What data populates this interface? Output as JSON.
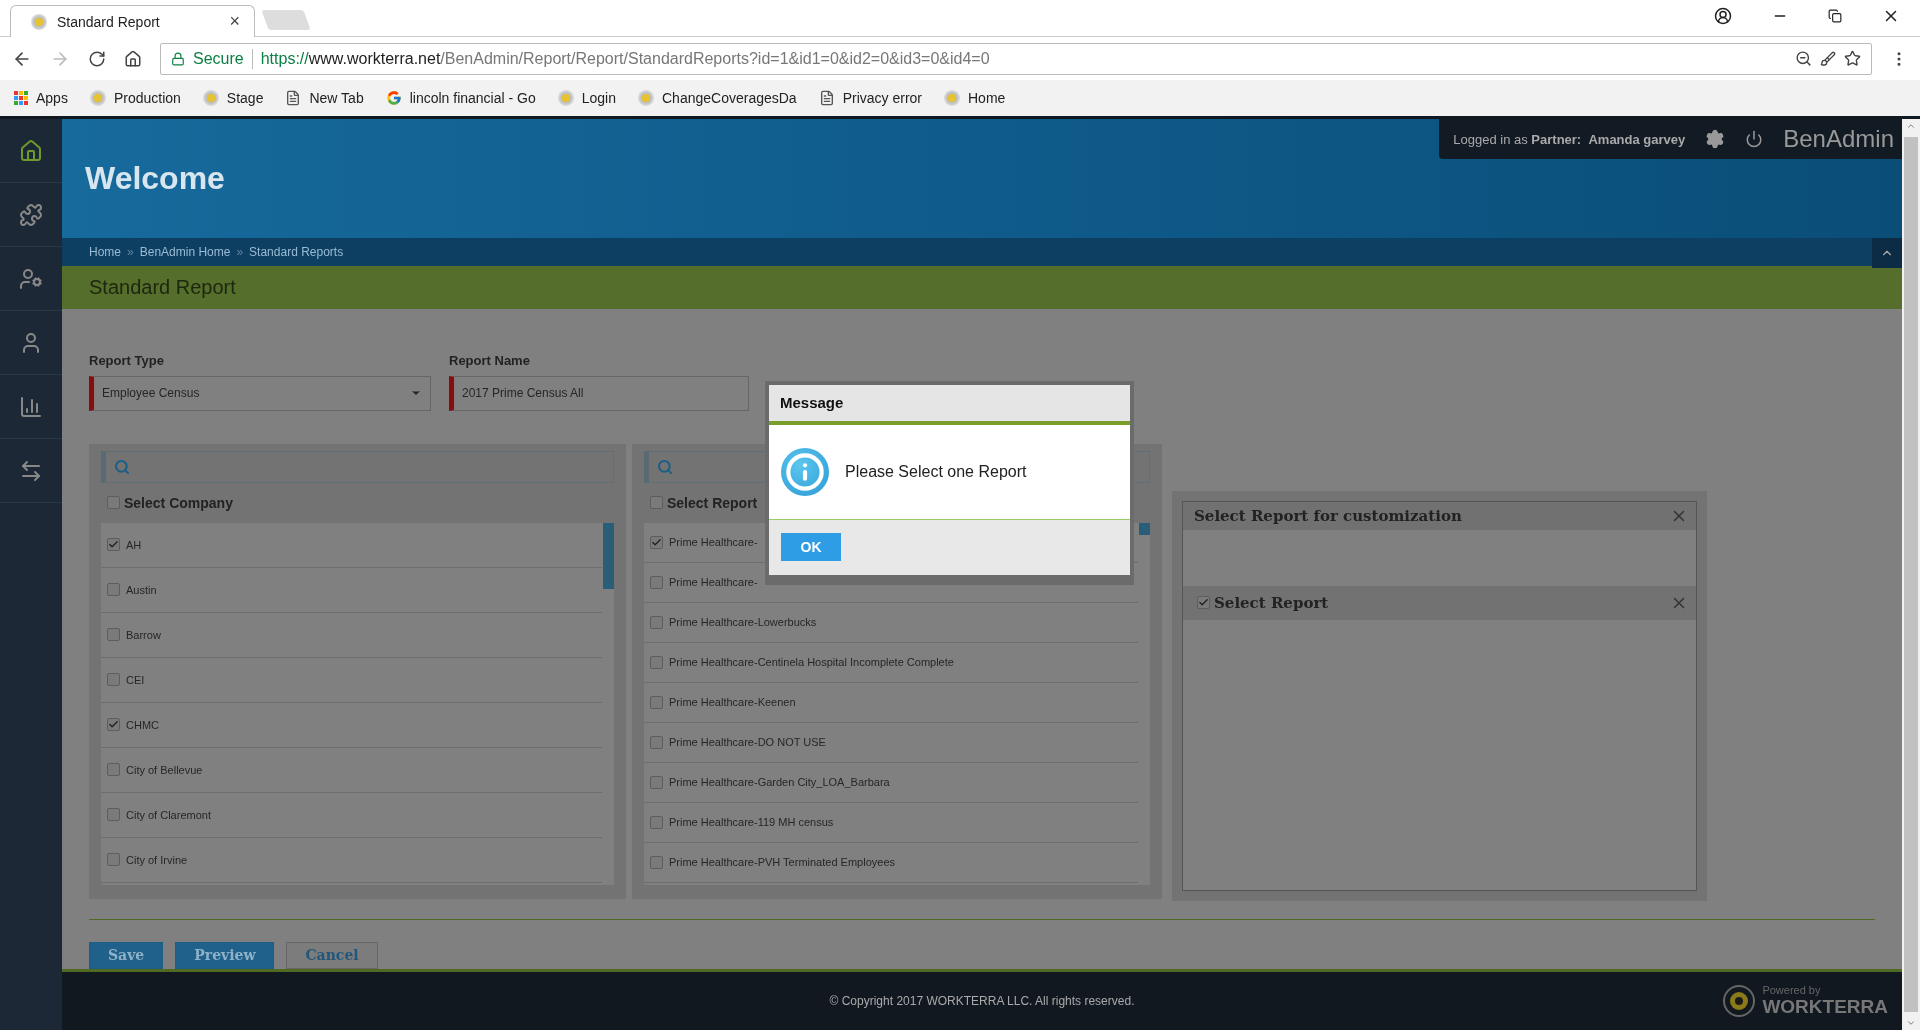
{
  "browser": {
    "tab": {
      "title": "Standard Report",
      "close": "×"
    },
    "address": {
      "secure_label": "Secure",
      "scheme": "https://",
      "host": "www.workterra.net",
      "path": "/BenAdmin/Report/Report/StandardReports?id=1&id1=0&id2=0&id3=0&id4=0"
    },
    "bookmarks": [
      {
        "label": "Apps",
        "kind": "apps"
      },
      {
        "label": "Production",
        "kind": "site"
      },
      {
        "label": "Stage",
        "kind": "site"
      },
      {
        "label": "New Tab",
        "kind": "page"
      },
      {
        "label": "lincoln financial - Go",
        "kind": "google"
      },
      {
        "label": "Login",
        "kind": "site"
      },
      {
        "label": "ChangeCoveragesDa",
        "kind": "site"
      },
      {
        "label": "Privacy error",
        "kind": "page"
      },
      {
        "label": "Home",
        "kind": "site"
      }
    ]
  },
  "header": {
    "welcome": "Welcome",
    "user_prefix": "Logged in as",
    "role": "Partner:",
    "user_name": "Amanda garvey",
    "brand": "BenAdmin"
  },
  "breadcrumbs": {
    "separator": "»",
    "items": [
      "Home",
      "BenAdmin Home",
      "Standard Reports"
    ]
  },
  "page_title": "Standard Report",
  "report_type": {
    "label": "Report Type",
    "value": "Employee Census"
  },
  "report_name": {
    "label": "Report Name",
    "value": "2017 Prime Census All"
  },
  "company_panel": {
    "header": "Select Company",
    "all_checked": false,
    "items": [
      {
        "label": "AH",
        "checked": true
      },
      {
        "label": "Austin",
        "checked": false
      },
      {
        "label": "Barrow",
        "checked": false
      },
      {
        "label": "CEI",
        "checked": false
      },
      {
        "label": "CHMC",
        "checked": true
      },
      {
        "label": "City of Bellevue",
        "checked": false
      },
      {
        "label": "City of Claremont",
        "checked": false
      },
      {
        "label": "City of Irvine",
        "checked": false
      }
    ]
  },
  "report_panel": {
    "header": "Select Report",
    "all_checked": false,
    "items": [
      {
        "label": "Prime Healthcare-",
        "checked": true
      },
      {
        "label": "Prime Healthcare-",
        "checked": false
      },
      {
        "label": "Prime Healthcare-Lowerbucks",
        "checked": false
      },
      {
        "label": "Prime Healthcare-Centinela Hospital Incomplete Complete",
        "checked": false
      },
      {
        "label": "Prime Healthcare-Keenen",
        "checked": false
      },
      {
        "label": "Prime Healthcare-DO NOT USE",
        "checked": false
      },
      {
        "label": "Prime Healthcare-Garden City_LOA_Barbara",
        "checked": false
      },
      {
        "label": "Prime Healthcare-119 MH census",
        "checked": false
      },
      {
        "label": "Prime Healthcare-PVH Terminated Employees",
        "checked": false
      }
    ]
  },
  "custom_panel": {
    "title": "Select Report for customization",
    "section": {
      "label": "Select Report",
      "checked": true
    }
  },
  "buttons": [
    {
      "label": "Save",
      "kind": "primary"
    },
    {
      "label": "Preview",
      "kind": "primary"
    },
    {
      "label": "Cancel",
      "kind": "secondary"
    }
  ],
  "footer": {
    "copyright": "© Copyright 2017 WORKTERRA LLC. All rights reserved.",
    "powered_by": "Powered by",
    "brand": "WORKTERRA"
  },
  "dialog": {
    "title": "Message",
    "message": "Please Select one Report",
    "ok": "OK"
  }
}
